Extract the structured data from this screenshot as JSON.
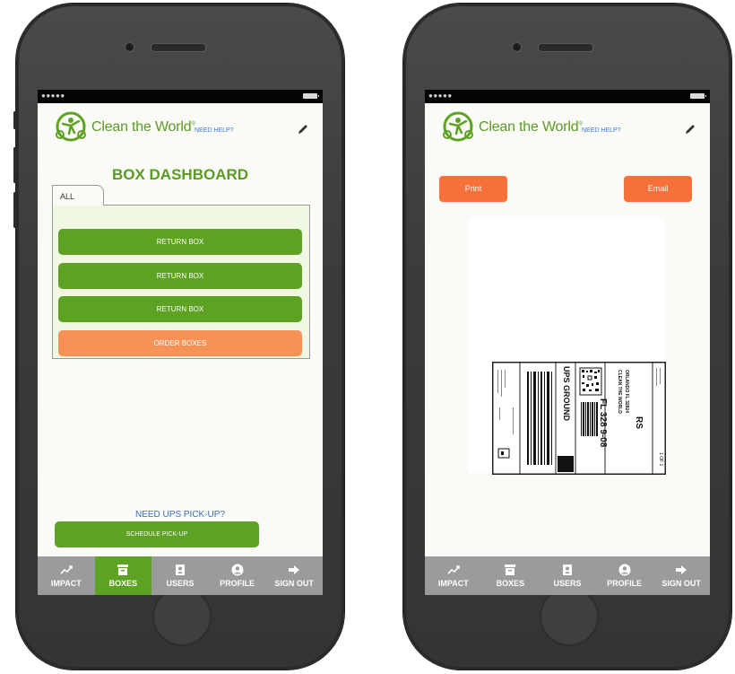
{
  "left_screen": {
    "brand": "Clean the World",
    "help": "NEED HELP?",
    "title": "BOX DASHBOARD",
    "tab": "ALL",
    "buttons": [
      "RETURN BOX",
      "RETURN BOX",
      "RETURN BOX"
    ],
    "order": "ORDER BOXES",
    "ups_prompt": "NEED UPS PICK-UP?",
    "schedule": "SCHEDULE PICK-UP",
    "nav": [
      {
        "label": "IMPACT",
        "icon": "trend-icon"
      },
      {
        "label": "BOXES",
        "icon": "archive-icon"
      },
      {
        "label": "USERS",
        "icon": "contact-icon"
      },
      {
        "label": "PROFILE",
        "icon": "user-circle-icon"
      },
      {
        "label": "SIGN OUT",
        "icon": "sign-out-icon"
      }
    ],
    "active_nav": "BOXES"
  },
  "right_screen": {
    "brand": "Clean the World",
    "help": "NEED HELP?",
    "print": "Print",
    "email": "Email",
    "label_text": {
      "service": "UPS GROUND",
      "zip_route": "FL 328 9-08",
      "to_line1": "CLEAN THE WORLD",
      "to_line2": "ORLANDO FL 32824",
      "weight": "1 OF 1",
      "rs": "RS"
    },
    "nav": [
      {
        "label": "IMPACT",
        "icon": "trend-icon"
      },
      {
        "label": "BOXES",
        "icon": "archive-icon"
      },
      {
        "label": "USERS",
        "icon": "contact-icon"
      },
      {
        "label": "PROFILE",
        "icon": "user-circle-icon"
      },
      {
        "label": "SIGN OUT",
        "icon": "sign-out-icon"
      }
    ]
  },
  "colors": {
    "brand_green": "#5ea224",
    "accent_orange": "#f79257",
    "print_orange": "#f7703a",
    "link_blue": "#3a7bd5"
  }
}
